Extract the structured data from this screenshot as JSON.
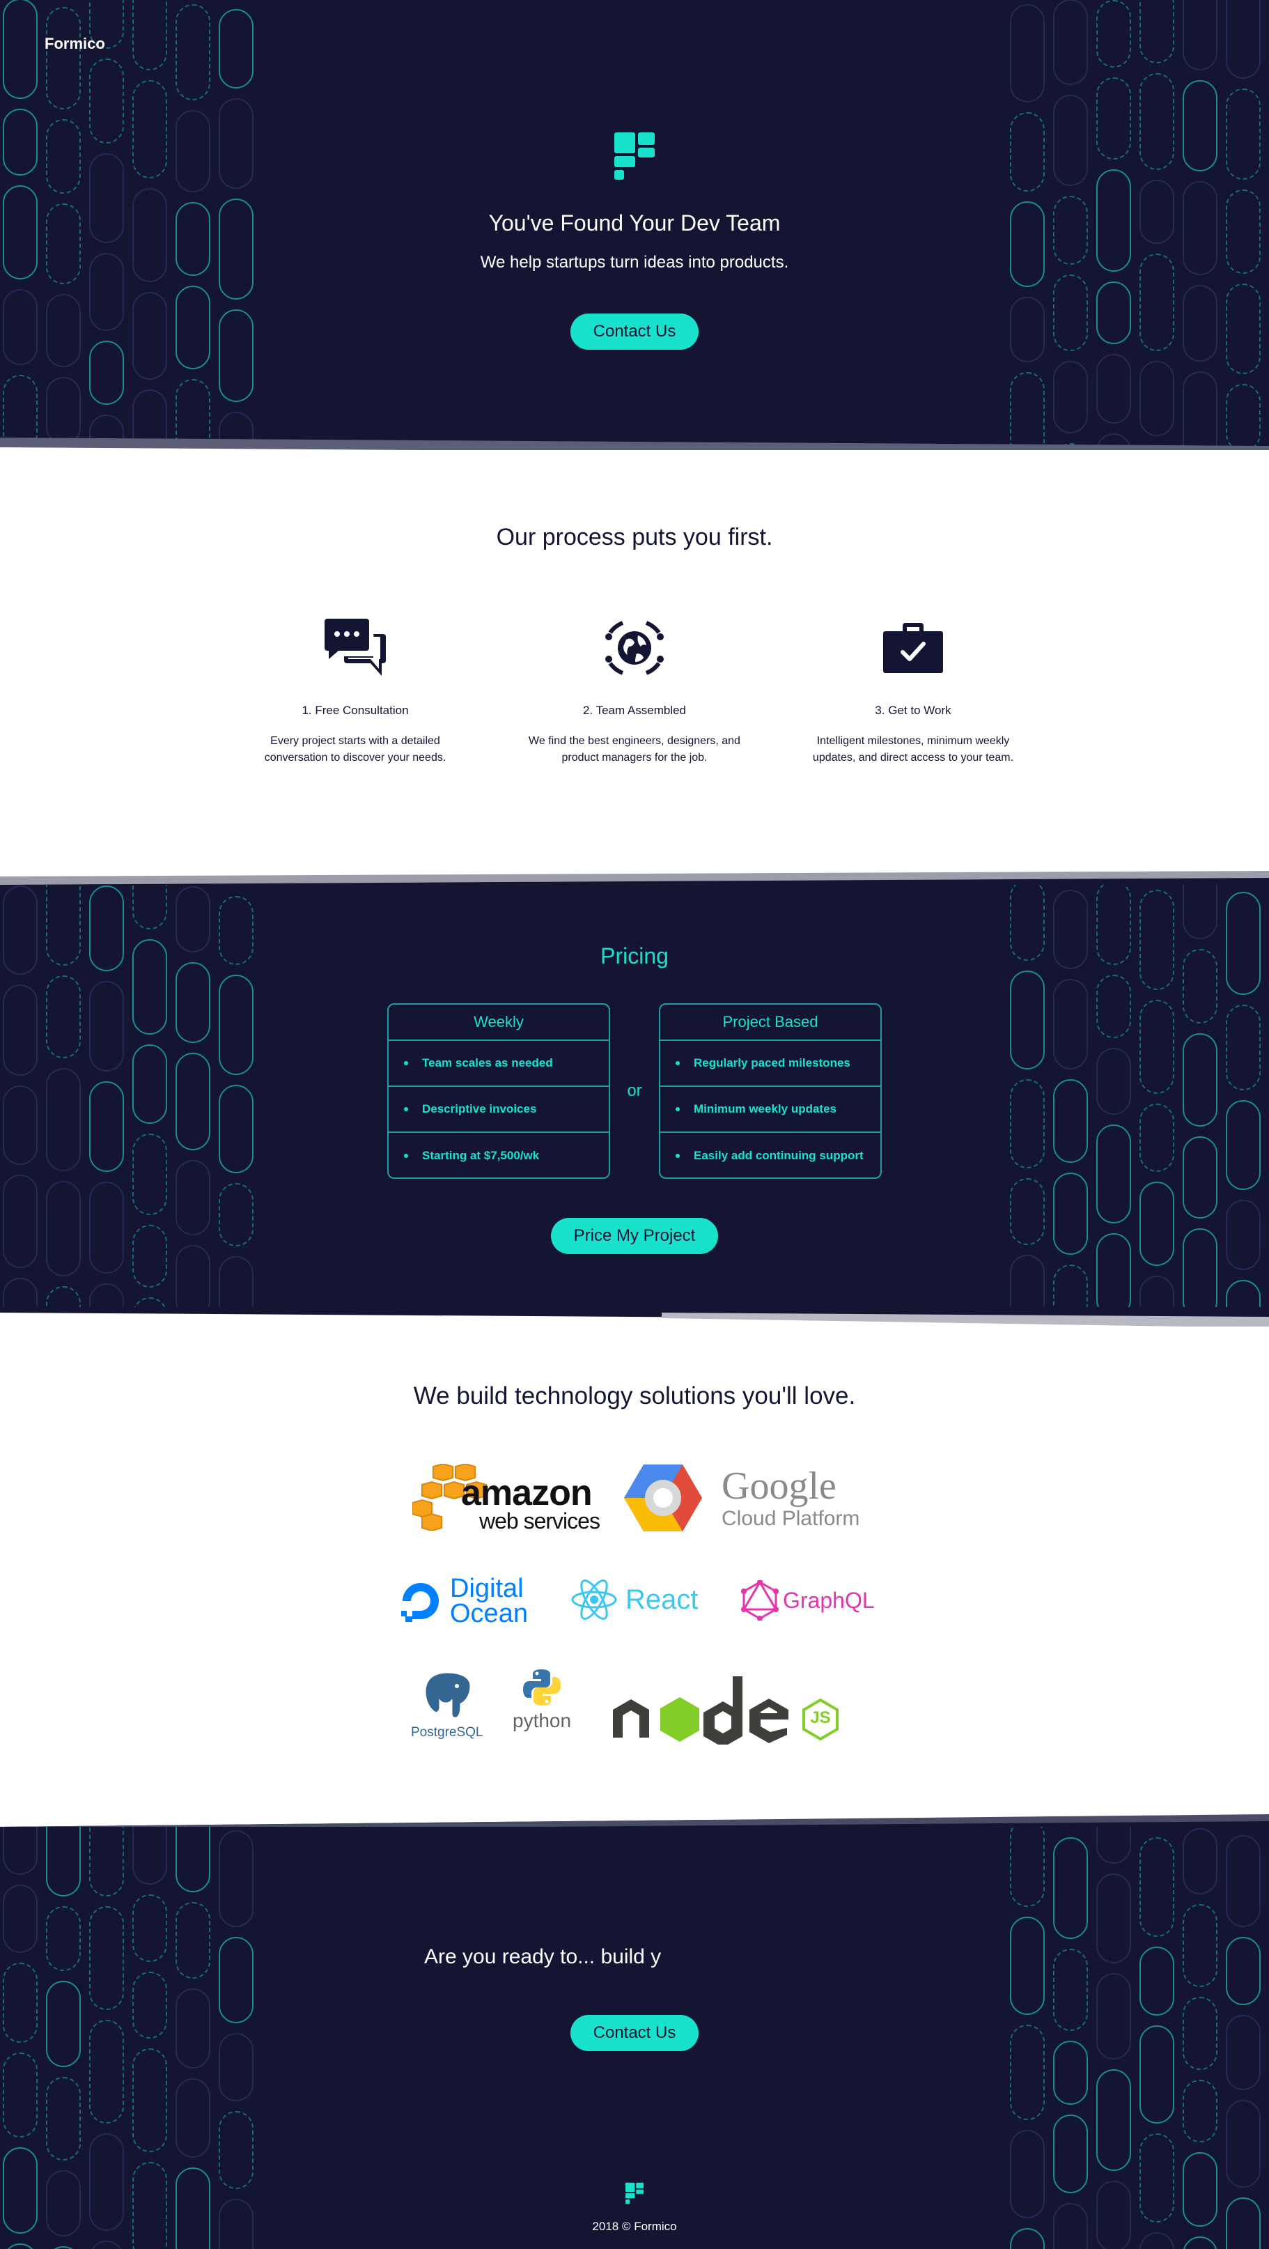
{
  "brand": "Formico",
  "hero": {
    "title": "You've Found Your Dev Team",
    "subtitle": "We help startups turn ideas into products.",
    "cta": "Contact Us"
  },
  "process": {
    "heading": "Our process puts you first.",
    "steps": [
      {
        "icon": "chat-bubbles-icon",
        "title": "1. Free Consultation",
        "desc_line1": "Every project starts with a detailed",
        "desc_line2": "conversation to discover your needs."
      },
      {
        "icon": "globe-team-icon",
        "title": "2. Team Assembled",
        "desc_line1": "We find the best engineers, designers, and",
        "desc_line2": "product managers for the job."
      },
      {
        "icon": "briefcase-check-icon",
        "title": "3. Get to Work",
        "desc_line1": "Intelligent milestones, minimum weekly",
        "desc_line2": "updates, and direct access to your team."
      }
    ]
  },
  "pricing": {
    "heading": "Pricing",
    "or": "or",
    "cards": [
      {
        "title": "Weekly",
        "items": [
          "Team scales as needed",
          "Descriptive invoices",
          "Starting at $7,500/wk"
        ]
      },
      {
        "title": "Project Based",
        "items": [
          "Regularly paced milestones",
          "Minimum weekly updates",
          "Easily add continuing support"
        ]
      }
    ],
    "cta": "Price My Project"
  },
  "tech": {
    "heading": "We build technology solutions you'll love.",
    "logos": {
      "aws_line1": "amazon",
      "aws_line2": "web services",
      "gcp_line1": "Google",
      "gcp_line2": "Cloud Platform",
      "do_line1": "Digital",
      "do_line2": "Ocean",
      "react": "React",
      "graphql": "GraphQL",
      "postgres": "PostgreSQL",
      "python": "python",
      "node": "node",
      "js": "JS"
    }
  },
  "footer_cta": {
    "text": "Are you ready to... build y",
    "cta": "Contact Us"
  },
  "footer": {
    "copyright": "2018 © Formico"
  },
  "colors": {
    "navy": "#141533",
    "teal": "#19e2cc",
    "white": "#ffffff"
  }
}
